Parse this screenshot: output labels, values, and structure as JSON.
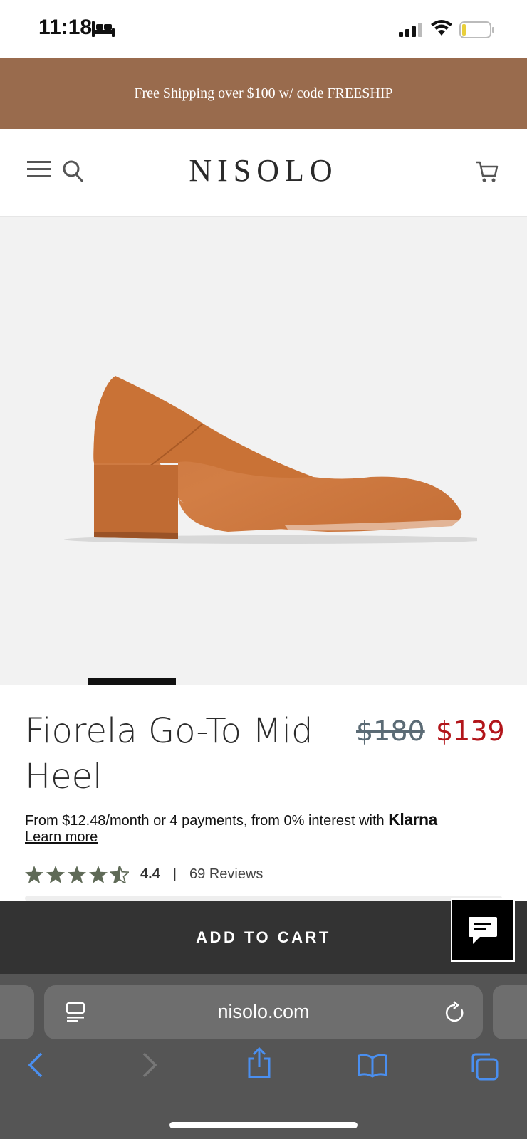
{
  "status_bar": {
    "time": "11:18"
  },
  "promo_banner": {
    "text": "Free Shipping over $100 w/ code FREESHIP"
  },
  "header": {
    "logo": "NISOLO"
  },
  "product": {
    "title": "Fiorela Go-To Mid Heel",
    "price_original": "$180",
    "price_sale": "$139",
    "financing_text": "From $12.48/month or 4 payments, from 0% interest with",
    "financing_brand": "Klarna",
    "learn_more": "Learn more",
    "rating": "4.4",
    "rating_stars": 4.5,
    "rating_separator": "|",
    "review_count": "69 Reviews"
  },
  "cta": {
    "add_to_cart": "ADD TO CART"
  },
  "browser": {
    "url": "nisolo.com"
  },
  "colors": {
    "promo_bg": "#996b4d",
    "sale_price": "#b2151a",
    "star": "#5f6a57",
    "cta_bg": "#333333",
    "safari_blue": "#4a8ff0"
  },
  "icons": [
    "sleep-icon",
    "signal-icon",
    "wifi-icon",
    "battery-icon",
    "menu-icon",
    "search-icon",
    "cart-icon",
    "star-icon",
    "chat-icon",
    "reader-icon",
    "reload-icon",
    "back-icon",
    "forward-icon",
    "share-icon",
    "bookmarks-icon",
    "tabs-icon"
  ]
}
